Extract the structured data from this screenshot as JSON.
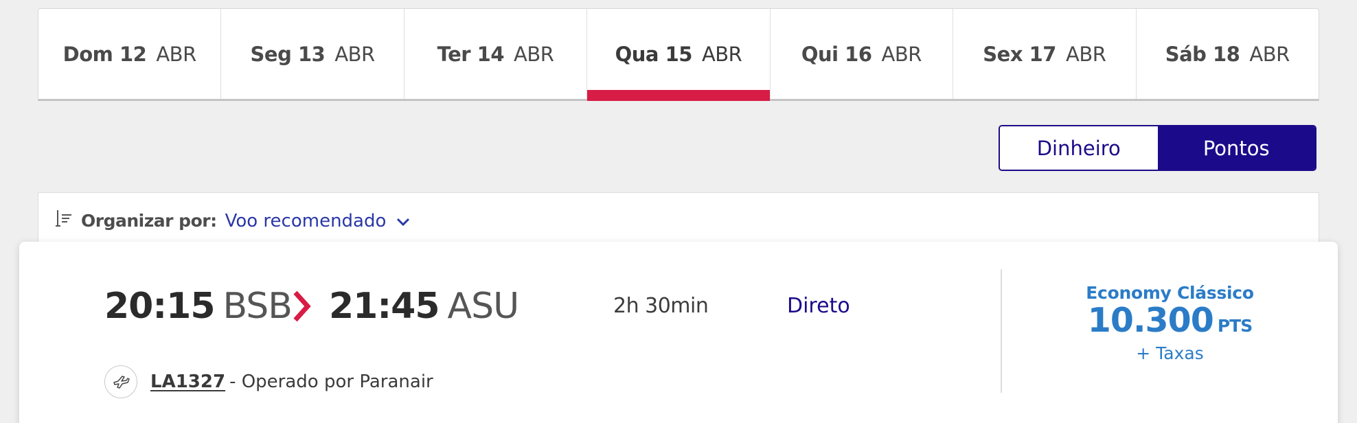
{
  "date_tabs": [
    {
      "day": "Dom 12",
      "month": "ABR"
    },
    {
      "day": "Seg 13",
      "month": "ABR"
    },
    {
      "day": "Ter 14",
      "month": "ABR"
    },
    {
      "day": "Qua 15",
      "month": "ABR"
    },
    {
      "day": "Qui 16",
      "month": "ABR"
    },
    {
      "day": "Sex 17",
      "month": "ABR"
    },
    {
      "day": "Sáb 18",
      "month": "ABR"
    }
  ],
  "currency_toggle": {
    "money_label": "Dinheiro",
    "points_label": "Pontos",
    "selected": "Pontos"
  },
  "sort": {
    "label": "Organizar por:",
    "value": "Voo recomendado"
  },
  "flight": {
    "departure_time": "20:15",
    "departure_airport": "BSB",
    "arrival_time": "21:45",
    "arrival_airport": "ASU",
    "duration": "2h 30min",
    "stops": "Direto",
    "flight_number": "LA1327",
    "operated_by": "- Operado por Paranair",
    "fare_class": "Economy Clássico",
    "points": "10.300",
    "points_unit": "PTS",
    "taxes": "+ Taxas"
  },
  "colors": {
    "accent_red": "#d71c46",
    "brand_navy": "#1b0b8a",
    "fare_blue": "#2b7cc7",
    "link_blue": "#2a37a6"
  },
  "icons": {
    "sort": "sort-lines-icon",
    "chevron": "chevron-down-icon",
    "arrow": "chevron-right-icon",
    "plane": "plane-icon"
  }
}
